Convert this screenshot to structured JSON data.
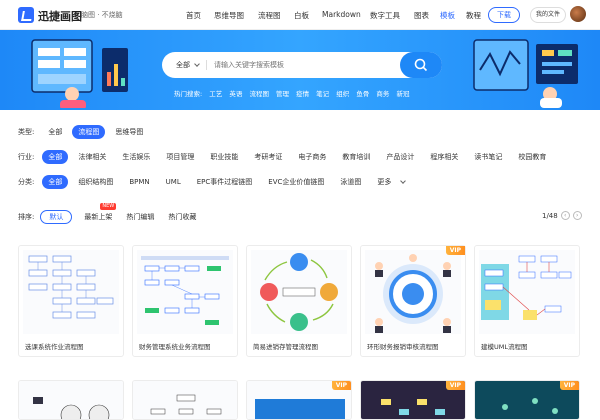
{
  "nav": {
    "brand": "迅捷画图",
    "slogan": "脑图 · 不烧脑",
    "links": [
      "首页",
      "思维导图",
      "流程图",
      "白板",
      "Markdown",
      "数字工具",
      "图表",
      "模板",
      "教程"
    ],
    "active_index": 7,
    "download_label": "下载",
    "my_files_label": "我的文件"
  },
  "hero": {
    "search": {
      "select_label": "全部",
      "placeholder": "请输入关键字搜索模板"
    },
    "hot_label": "热门搜索:",
    "hot_terms": [
      "工艺",
      "英语",
      "流程图",
      "管理",
      "疫情",
      "笔记",
      "组织",
      "鱼骨",
      "商务",
      "新冠"
    ]
  },
  "filters": {
    "type": {
      "label": "类型:",
      "options": [
        "全部",
        "流程图",
        "思维导图"
      ],
      "selected": 1
    },
    "industry": {
      "label": "行业:",
      "options": [
        "全部",
        "法律相关",
        "生活娱乐",
        "项目管理",
        "职业技能",
        "考研考证",
        "电子商务",
        "教育培训",
        "产品设计",
        "程序相关",
        "读书笔记",
        "校园教育"
      ],
      "selected": 0
    },
    "category": {
      "label": "分类:",
      "options": [
        "全部",
        "组织结构图",
        "BPMN",
        "UML",
        "EPC事件过程链图",
        "EVC企业价值链图",
        "泳道图",
        "更多"
      ],
      "selected": 0
    }
  },
  "sort": {
    "label": "排序:",
    "default_label": "默认",
    "items": [
      "最新上架",
      "热门编辑",
      "热门收藏"
    ],
    "new_badge": "NEW",
    "pager": "1/48"
  },
  "cards": [
    {
      "caption": "选课系统作业流程图",
      "vip": false
    },
    {
      "caption": "财务管理系统业务流程图",
      "vip": false
    },
    {
      "caption": "简易进销存管理流程图",
      "vip": false
    },
    {
      "caption": "环形财务报销审核流程图",
      "vip": true
    },
    {
      "caption": "建模UML流程图",
      "vip": false
    }
  ],
  "vip_label": "VIP",
  "colors": {
    "accent": "#2f6bff",
    "hero": "#1e88f7",
    "vip": "#ff9a2a",
    "new": "#ff3b30"
  }
}
